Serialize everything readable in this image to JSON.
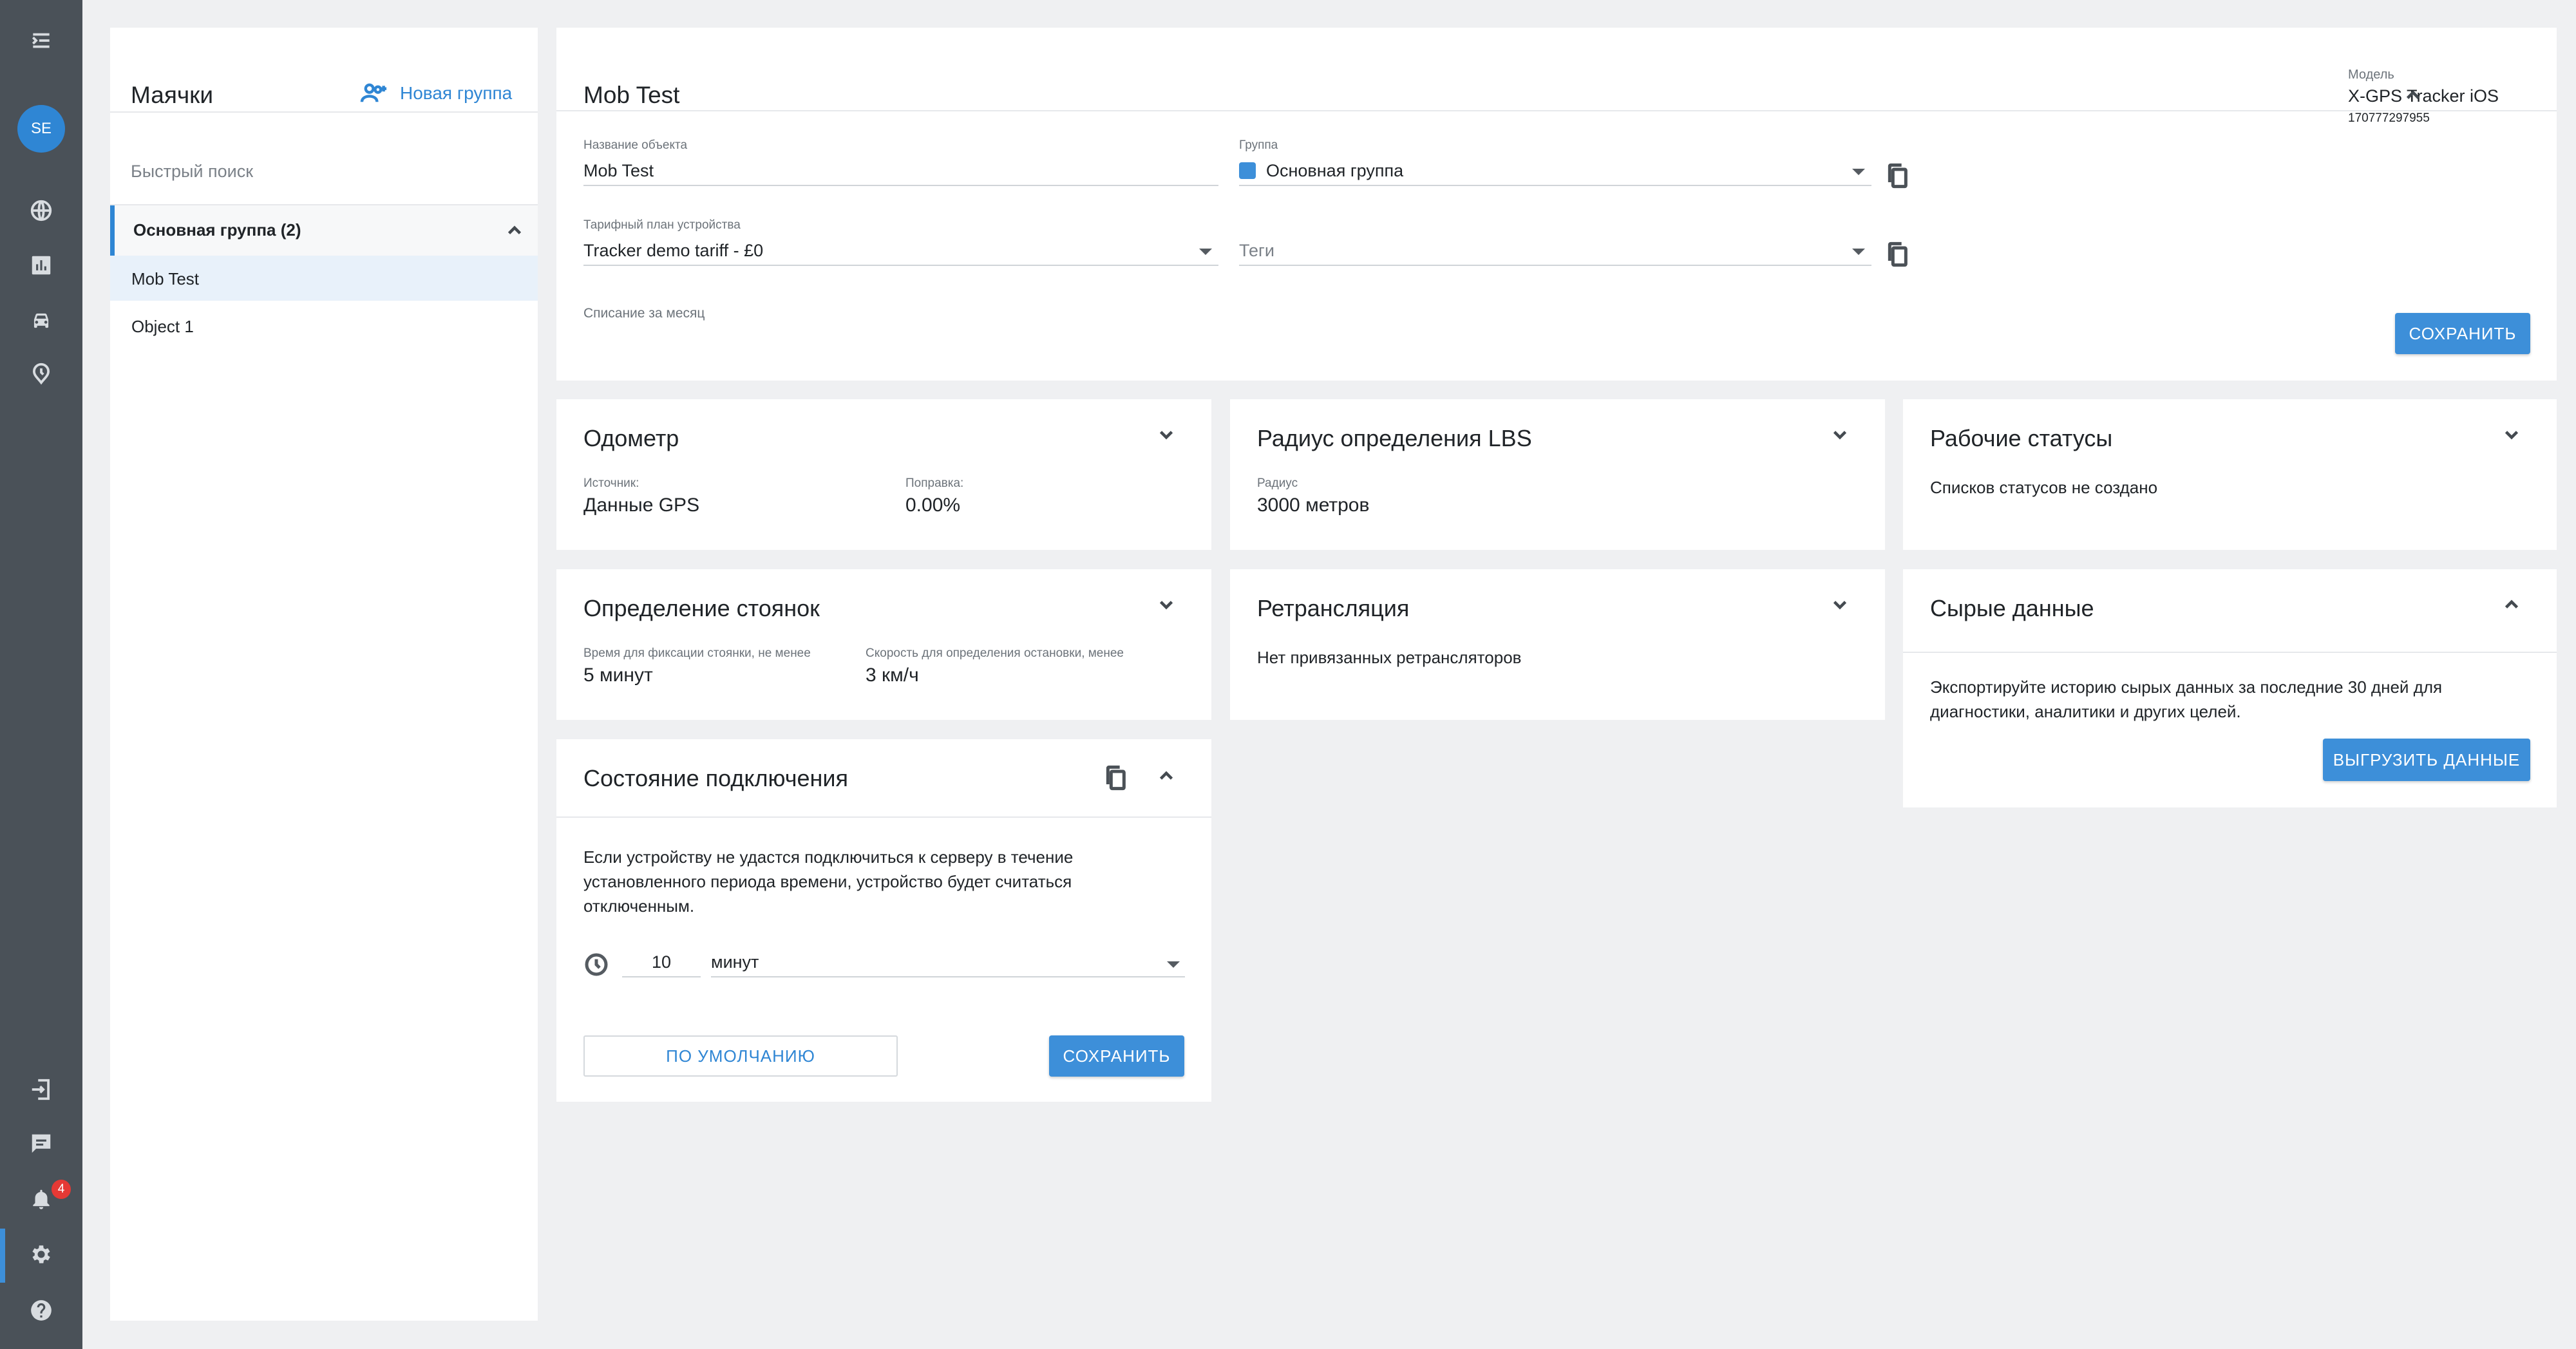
{
  "colors": {
    "accent": "#2f86d4",
    "primary_button": "#3d8fd9",
    "rail": "#4a5158",
    "badge": "#e53935",
    "group_swatch": "#3d8fd9"
  },
  "rail": {
    "avatar_initials": "SE",
    "notifications_badge": "4",
    "icons": [
      "menu-expand-icon",
      "globe-icon",
      "chart-icon",
      "car-icon",
      "history-clock-icon",
      "logout-icon",
      "chat-icon",
      "bell-icon",
      "gear-icon",
      "help-icon"
    ],
    "active_item": "gear-icon"
  },
  "beacons": {
    "title": "Маячки",
    "new_group_label": "Новая группа",
    "search_placeholder": "Быстрый поиск",
    "group_label": "Основная группа (2)",
    "items": [
      {
        "label": "Mob Test",
        "selected": true
      },
      {
        "label": "Object 1",
        "selected": false
      }
    ]
  },
  "object": {
    "title": "Mob Test",
    "model_caption": "Модель",
    "model_value": "X-GPS Tracker iOS",
    "model_id": "170777297955",
    "name_caption": "Название объекта",
    "name_value": "Mob Test",
    "group_caption": "Группа",
    "group_value": "Основная группа",
    "tariff_caption": "Тарифный план устройства",
    "tariff_value": "Tracker demo tariff - £0",
    "tags_placeholder": "Теги",
    "monthly_charge_label": "Списание за месяц",
    "save_label": "СОХРАНИТЬ"
  },
  "odometer": {
    "title": "Одометр",
    "source_caption": "Источник:",
    "source_value": "Данные GPS",
    "correction_caption": "Поправка:",
    "correction_value": "0.00%"
  },
  "lbs": {
    "title": "Радиус определения LBS",
    "radius_caption": "Радиус",
    "radius_value": "3000 метров"
  },
  "work_statuses": {
    "title": "Рабочие статусы",
    "empty_text": "Списков статусов не создано"
  },
  "parking": {
    "title": "Определение стоянок",
    "time_caption": "Время для фиксации стоянки, не менее",
    "time_value": "5 минут",
    "speed_caption": "Скорость для определения остановки, менее",
    "speed_value": "3 км/ч"
  },
  "relay": {
    "title": "Ретрансляция",
    "empty_text": "Нет привязанных ретрансляторов"
  },
  "raw_data": {
    "title": "Сырые данные",
    "description_line1": "Экспортируйте историю сырых данных за последние 30 дней для",
    "description_line2": "диагностики, аналитики и других целей.",
    "export_label": "ВЫГРУЗИТЬ ДАННЫЕ"
  },
  "connection": {
    "title": "Состояние подключения",
    "description_line1": "Если устройству не удастся подключиться к серверу в течение",
    "description_line2": "установленного периода времени, устройство будет считаться",
    "description_line3": "отключенным.",
    "timeout_value": "10",
    "unit_value": "минут",
    "default_label": "ПО УМОЛЧАНИЮ",
    "save_label": "СОХРАНИТЬ"
  }
}
